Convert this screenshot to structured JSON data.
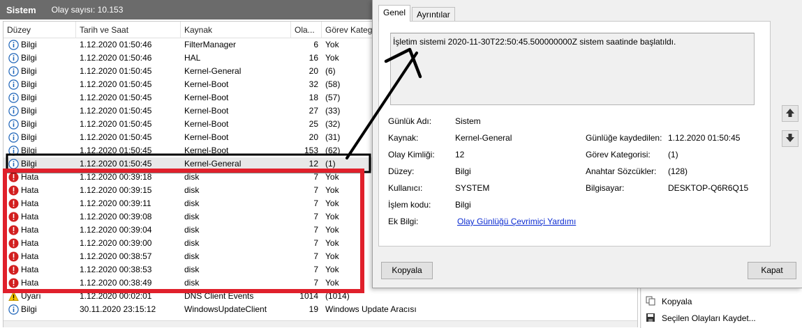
{
  "window": {
    "title": "Sistem",
    "event_count": "Olay sayısı: 10.153"
  },
  "columns": {
    "level": "Düzey",
    "datetime": "Tarih ve Saat",
    "source": "Kaynak",
    "event_id": "Ola...",
    "task_category": "Görev Katego"
  },
  "rows": [
    {
      "icon": "info-icon",
      "level": "Bilgi",
      "datetime": "1.12.2020 01:50:46",
      "source": "FilterManager",
      "event_id": "6",
      "category": "Yok"
    },
    {
      "icon": "info-icon",
      "level": "Bilgi",
      "datetime": "1.12.2020 01:50:46",
      "source": "HAL",
      "event_id": "16",
      "category": "Yok"
    },
    {
      "icon": "info-icon",
      "level": "Bilgi",
      "datetime": "1.12.2020 01:50:45",
      "source": "Kernel-General",
      "event_id": "20",
      "category": "(6)"
    },
    {
      "icon": "info-icon",
      "level": "Bilgi",
      "datetime": "1.12.2020 01:50:45",
      "source": "Kernel-Boot",
      "event_id": "32",
      "category": "(58)"
    },
    {
      "icon": "info-icon",
      "level": "Bilgi",
      "datetime": "1.12.2020 01:50:45",
      "source": "Kernel-Boot",
      "event_id": "18",
      "category": "(57)"
    },
    {
      "icon": "info-icon",
      "level": "Bilgi",
      "datetime": "1.12.2020 01:50:45",
      "source": "Kernel-Boot",
      "event_id": "27",
      "category": "(33)"
    },
    {
      "icon": "info-icon",
      "level": "Bilgi",
      "datetime": "1.12.2020 01:50:45",
      "source": "Kernel-Boot",
      "event_id": "25",
      "category": "(32)"
    },
    {
      "icon": "info-icon",
      "level": "Bilgi",
      "datetime": "1.12.2020 01:50:45",
      "source": "Kernel-Boot",
      "event_id": "20",
      "category": "(31)"
    },
    {
      "icon": "info-icon",
      "level": "Bilgi",
      "datetime": "1.12.2020 01:50:45",
      "source": "Kernel-Boot",
      "event_id": "153",
      "category": "(62)"
    },
    {
      "icon": "info-icon",
      "level": "Bilgi",
      "datetime": "1.12.2020 01:50:45",
      "source": "Kernel-General",
      "event_id": "12",
      "category": "(1)",
      "selected": true
    },
    {
      "icon": "error-icon",
      "level": "Hata",
      "datetime": "1.12.2020 00:39:18",
      "source": "disk",
      "event_id": "7",
      "category": "Yok"
    },
    {
      "icon": "error-icon",
      "level": "Hata",
      "datetime": "1.12.2020 00:39:15",
      "source": "disk",
      "event_id": "7",
      "category": "Yok"
    },
    {
      "icon": "error-icon",
      "level": "Hata",
      "datetime": "1.12.2020 00:39:11",
      "source": "disk",
      "event_id": "7",
      "category": "Yok"
    },
    {
      "icon": "error-icon",
      "level": "Hata",
      "datetime": "1.12.2020 00:39:08",
      "source": "disk",
      "event_id": "7",
      "category": "Yok"
    },
    {
      "icon": "error-icon",
      "level": "Hata",
      "datetime": "1.12.2020 00:39:04",
      "source": "disk",
      "event_id": "7",
      "category": "Yok"
    },
    {
      "icon": "error-icon",
      "level": "Hata",
      "datetime": "1.12.2020 00:39:00",
      "source": "disk",
      "event_id": "7",
      "category": "Yok"
    },
    {
      "icon": "error-icon",
      "level": "Hata",
      "datetime": "1.12.2020 00:38:57",
      "source": "disk",
      "event_id": "7",
      "category": "Yok"
    },
    {
      "icon": "error-icon",
      "level": "Hata",
      "datetime": "1.12.2020 00:38:53",
      "source": "disk",
      "event_id": "7",
      "category": "Yok"
    },
    {
      "icon": "error-icon",
      "level": "Hata",
      "datetime": "1.12.2020 00:38:49",
      "source": "disk",
      "event_id": "7",
      "category": "Yok"
    },
    {
      "icon": "warning-icon",
      "level": "Uyarı",
      "datetime": "1.12.2020 00:02:01",
      "source": "DNS Client Events",
      "event_id": "1014",
      "category": "(1014)"
    },
    {
      "icon": "info-icon",
      "level": "Bilgi",
      "datetime": "30.11.2020 23:15:12",
      "source": "WindowsUpdateClient",
      "event_id": "19",
      "category": "Windows Update Aracısı"
    }
  ],
  "actions": {
    "copy": "Kopyala",
    "save_selected": "Seçilen Olayları Kaydet..."
  },
  "dialog": {
    "tabs": {
      "general": "Genel",
      "details": "Ayrıntılar"
    },
    "description": "İşletim sistemi 2020-11-30T22:50:45.500000000Z sistem saatinde başlatıldı.",
    "fields": {
      "log_name_label": "Günlük Adı:",
      "log_name_value": "Sistem",
      "source_label": "Kaynak:",
      "source_value": "Kernel-General",
      "logged_label": "Günlüğe kaydedilen:",
      "logged_value": "1.12.2020 01:50:45",
      "event_id_label": "Olay Kimliği:",
      "event_id_value": "12",
      "task_label": "Görev Kategorisi:",
      "task_value": "(1)",
      "level_label": "Düzey:",
      "level_value": "Bilgi",
      "keywords_label": "Anahtar Sözcükler:",
      "keywords_value": "(128)",
      "user_label": "Kullanıcı:",
      "user_value": "SYSTEM",
      "computer_label": "Bilgisayar:",
      "computer_value": "DESKTOP-Q6R6Q15",
      "opcode_label": "İşlem kodu:",
      "opcode_value": "Bilgi",
      "more_info_label": "Ek Bilgi:",
      "more_info_link": "Olay Günlüğü Çevrimiçi Yardımı"
    },
    "buttons": {
      "copy": "Kopyala",
      "close": "Kapat"
    }
  },
  "colors": {
    "info": "#1c63b8",
    "error": "#d21f1f",
    "warning": "#f5c400",
    "red_annotation": "#e0202b",
    "black_annotation": "#000000",
    "link": "#0b2bd1"
  }
}
